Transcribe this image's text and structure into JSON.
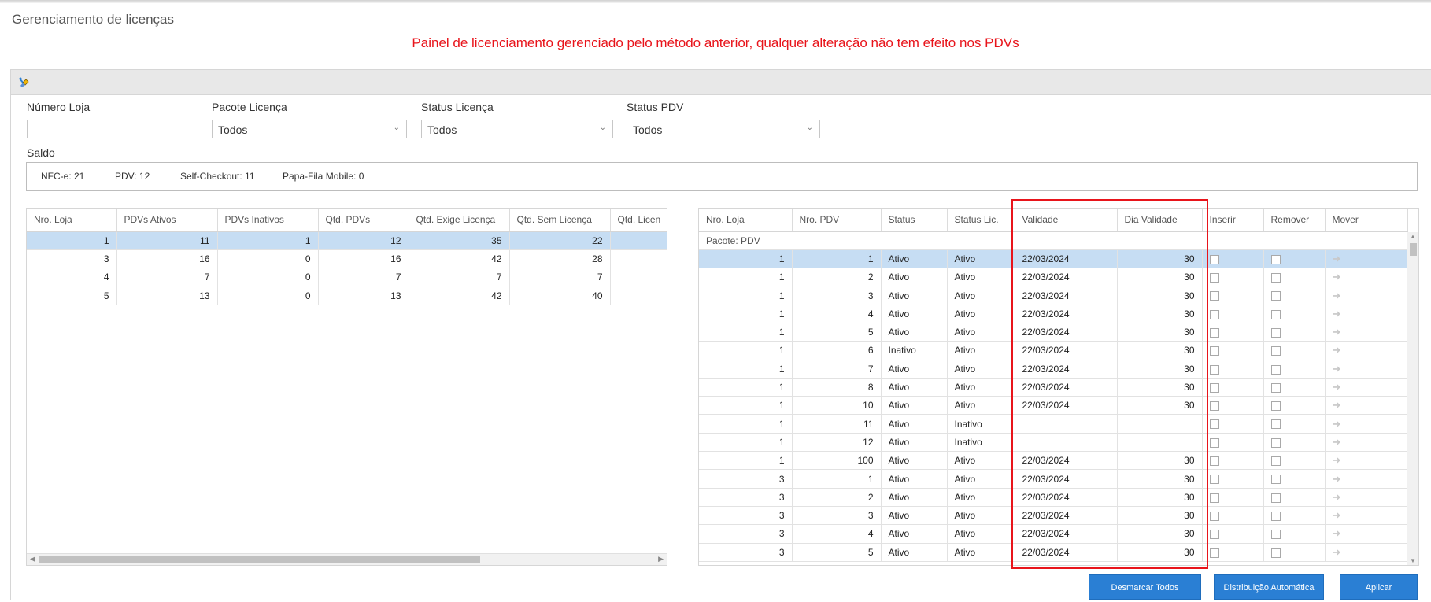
{
  "page_title": "Gerenciamento de licenças",
  "warning": "Painel de licenciamento gerenciado pelo método anterior, qualquer alteração não tem efeito nos PDVs",
  "filters": {
    "numero_loja": {
      "label": "Número Loja",
      "value": ""
    },
    "pacote_licenca": {
      "label": "Pacote Licença",
      "value": "Todos"
    },
    "status_licenca": {
      "label": "Status Licença",
      "value": "Todos"
    },
    "status_pdv": {
      "label": "Status PDV",
      "value": "Todos"
    }
  },
  "saldo": {
    "label": "Saldo",
    "items": [
      "NFC-e: 21",
      "PDV: 12",
      "Self-Checkout: 11",
      "Papa-Fila Mobile: 0"
    ]
  },
  "left_grid": {
    "columns": [
      "Nro. Loja",
      "PDVs Ativos",
      "PDVs Inativos",
      "Qtd. PDVs",
      "Qtd. Exige Licença",
      "Qtd. Sem Licença",
      "Qtd. Licen"
    ],
    "rows": [
      [
        "1",
        "11",
        "1",
        "12",
        "35",
        "22",
        ""
      ],
      [
        "3",
        "16",
        "0",
        "16",
        "42",
        "28",
        ""
      ],
      [
        "4",
        "7",
        "0",
        "7",
        "7",
        "7",
        ""
      ],
      [
        "5",
        "13",
        "0",
        "13",
        "42",
        "40",
        ""
      ]
    ],
    "selected_row": 0
  },
  "right_grid": {
    "columns": [
      "Nro. Loja",
      "Nro. PDV",
      "Status",
      "Status Lic.",
      "Validade",
      "Dia Validade",
      "Inserir",
      "Remover",
      "Mover"
    ],
    "group_label": "Pacote: PDV",
    "rows": [
      [
        "1",
        "1",
        "Ativo",
        "Ativo",
        "22/03/2024",
        "30"
      ],
      [
        "1",
        "2",
        "Ativo",
        "Ativo",
        "22/03/2024",
        "30"
      ],
      [
        "1",
        "3",
        "Ativo",
        "Ativo",
        "22/03/2024",
        "30"
      ],
      [
        "1",
        "4",
        "Ativo",
        "Ativo",
        "22/03/2024",
        "30"
      ],
      [
        "1",
        "5",
        "Ativo",
        "Ativo",
        "22/03/2024",
        "30"
      ],
      [
        "1",
        "6",
        "Inativo",
        "Ativo",
        "22/03/2024",
        "30"
      ],
      [
        "1",
        "7",
        "Ativo",
        "Ativo",
        "22/03/2024",
        "30"
      ],
      [
        "1",
        "8",
        "Ativo",
        "Ativo",
        "22/03/2024",
        "30"
      ],
      [
        "1",
        "10",
        "Ativo",
        "Ativo",
        "22/03/2024",
        "30"
      ],
      [
        "1",
        "11",
        "Ativo",
        "Inativo",
        "",
        ""
      ],
      [
        "1",
        "12",
        "Ativo",
        "Inativo",
        "",
        ""
      ],
      [
        "1",
        "100",
        "Ativo",
        "Ativo",
        "22/03/2024",
        "30"
      ],
      [
        "3",
        "1",
        "Ativo",
        "Ativo",
        "22/03/2024",
        "30"
      ],
      [
        "3",
        "2",
        "Ativo",
        "Ativo",
        "22/03/2024",
        "30"
      ],
      [
        "3",
        "3",
        "Ativo",
        "Ativo",
        "22/03/2024",
        "30"
      ],
      [
        "3",
        "4",
        "Ativo",
        "Ativo",
        "22/03/2024",
        "30"
      ],
      [
        "3",
        "5",
        "Ativo",
        "Ativo",
        "22/03/2024",
        "30"
      ]
    ],
    "selected_row": 0
  },
  "buttons": {
    "desmarcar": "Desmarcar Todos",
    "distribuicao": "Distribuição Automática",
    "aplicar": "Aplicar"
  },
  "colors": {
    "warning": "#e8141b",
    "selected_row": "#c6ddf3",
    "button": "#2a7fd4",
    "highlight": "#e8141b"
  }
}
